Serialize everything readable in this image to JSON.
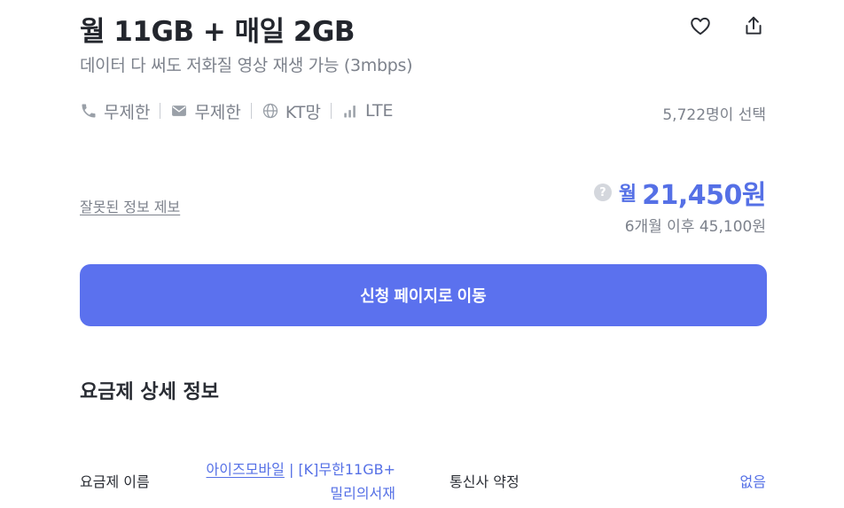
{
  "plan": {
    "title": "월 11GB + 매일 2GB",
    "subtitle": "데이터 다 써도 저화질 영상 재생 가능 (3mbps)",
    "features": [
      {
        "icon": "phone-icon",
        "label": "무제한"
      },
      {
        "icon": "message-icon",
        "label": "무제한"
      },
      {
        "icon": "globe-icon",
        "label": "KT망"
      },
      {
        "icon": "signal-icon",
        "label": "LTE"
      }
    ],
    "selected_count": "5,722명이 선택"
  },
  "actions": {
    "favorite_icon": "heart-icon",
    "share_icon": "share-icon"
  },
  "report_link": "잘못된 정보 제보",
  "price": {
    "help_icon": "?",
    "prefix": "월",
    "value": "21,450원",
    "after": "6개월 이후 45,100원"
  },
  "cta": {
    "label": "신청 페이지로 이동"
  },
  "details": {
    "section_title": "요금제 상세 정보",
    "plan_name_label": "요금제 이름",
    "plan_name_value_line1": "아이즈모바일",
    "plan_name_value_sep": " | [K]무한11GB+",
    "plan_name_value_line2": "밀리의서재",
    "contract_label": "통신사 약정",
    "contract_value": "없음"
  },
  "colors": {
    "accent": "#5570e6",
    "cta_background": "#5b71ee",
    "muted_text": "#7d828c",
    "title_text": "#23262d"
  }
}
